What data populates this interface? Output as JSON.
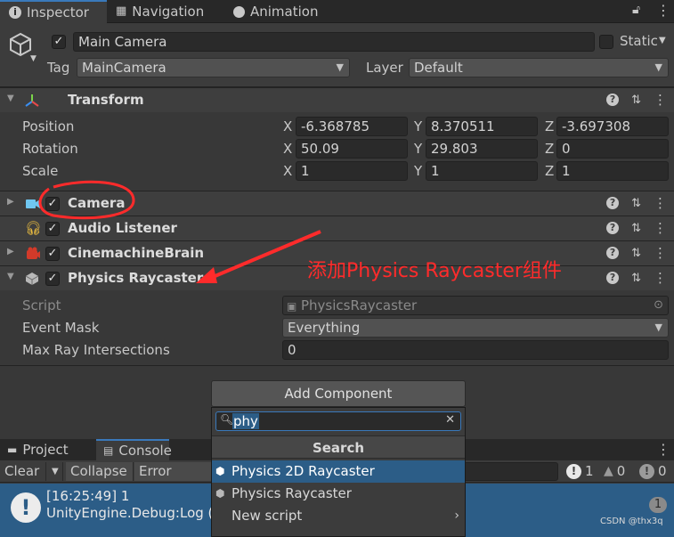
{
  "tabs": {
    "inspector": "Inspector",
    "navigation": "Navigation",
    "animation": "Animation"
  },
  "gameobject": {
    "name": "Main Camera",
    "static_label": "Static",
    "tag_label": "Tag",
    "tag_value": "MainCamera",
    "layer_label": "Layer",
    "layer_value": "Default"
  },
  "transform": {
    "title": "Transform",
    "rows": [
      {
        "label": "Position",
        "x": "-6.368785",
        "y": "8.370511",
        "z": "-3.697308"
      },
      {
        "label": "Rotation",
        "x": "50.09",
        "y": "29.803",
        "z": "0"
      },
      {
        "label": "Scale",
        "x": "1",
        "y": "1",
        "z": "1"
      }
    ],
    "axes": {
      "x": "X",
      "y": "Y",
      "z": "Z"
    }
  },
  "components": {
    "camera": "Camera",
    "audio_listener": "Audio Listener",
    "cinemachine_brain": "CinemachineBrain",
    "physics_raycaster": "Physics Raycaster"
  },
  "raycaster": {
    "script_label": "Script",
    "script_value": "PhysicsRaycaster",
    "event_mask_label": "Event Mask",
    "event_mask_value": "Everything",
    "max_ray_label": "Max Ray Intersections",
    "max_ray_value": "0"
  },
  "annotation": "添加Physics Raycaster组件",
  "add_component": {
    "button_label": "Add Component",
    "search_value": "phy",
    "search_header": "Search",
    "items": [
      {
        "label": "Physics 2D Raycaster",
        "selected": true
      },
      {
        "label": "Physics Raycaster",
        "selected": false
      },
      {
        "label": "New script",
        "selected": false
      }
    ]
  },
  "bottom_tabs": {
    "project": "Project",
    "console": "Console"
  },
  "console": {
    "clear": "Clear",
    "collapse": "Collapse",
    "error_pause": "Error Pause",
    "count_info": "1",
    "count_warn": "0",
    "count_error": "0",
    "log_line1": "[16:25:49] 1",
    "log_line2": "UnityEngine.Debug:Log (o",
    "log_count": "1"
  },
  "watermark": "CSDN @thx3q",
  "colors": {
    "accent": "#3a79bb",
    "selection": "#2c5d87",
    "annotation_red": "#ff2b2b"
  }
}
